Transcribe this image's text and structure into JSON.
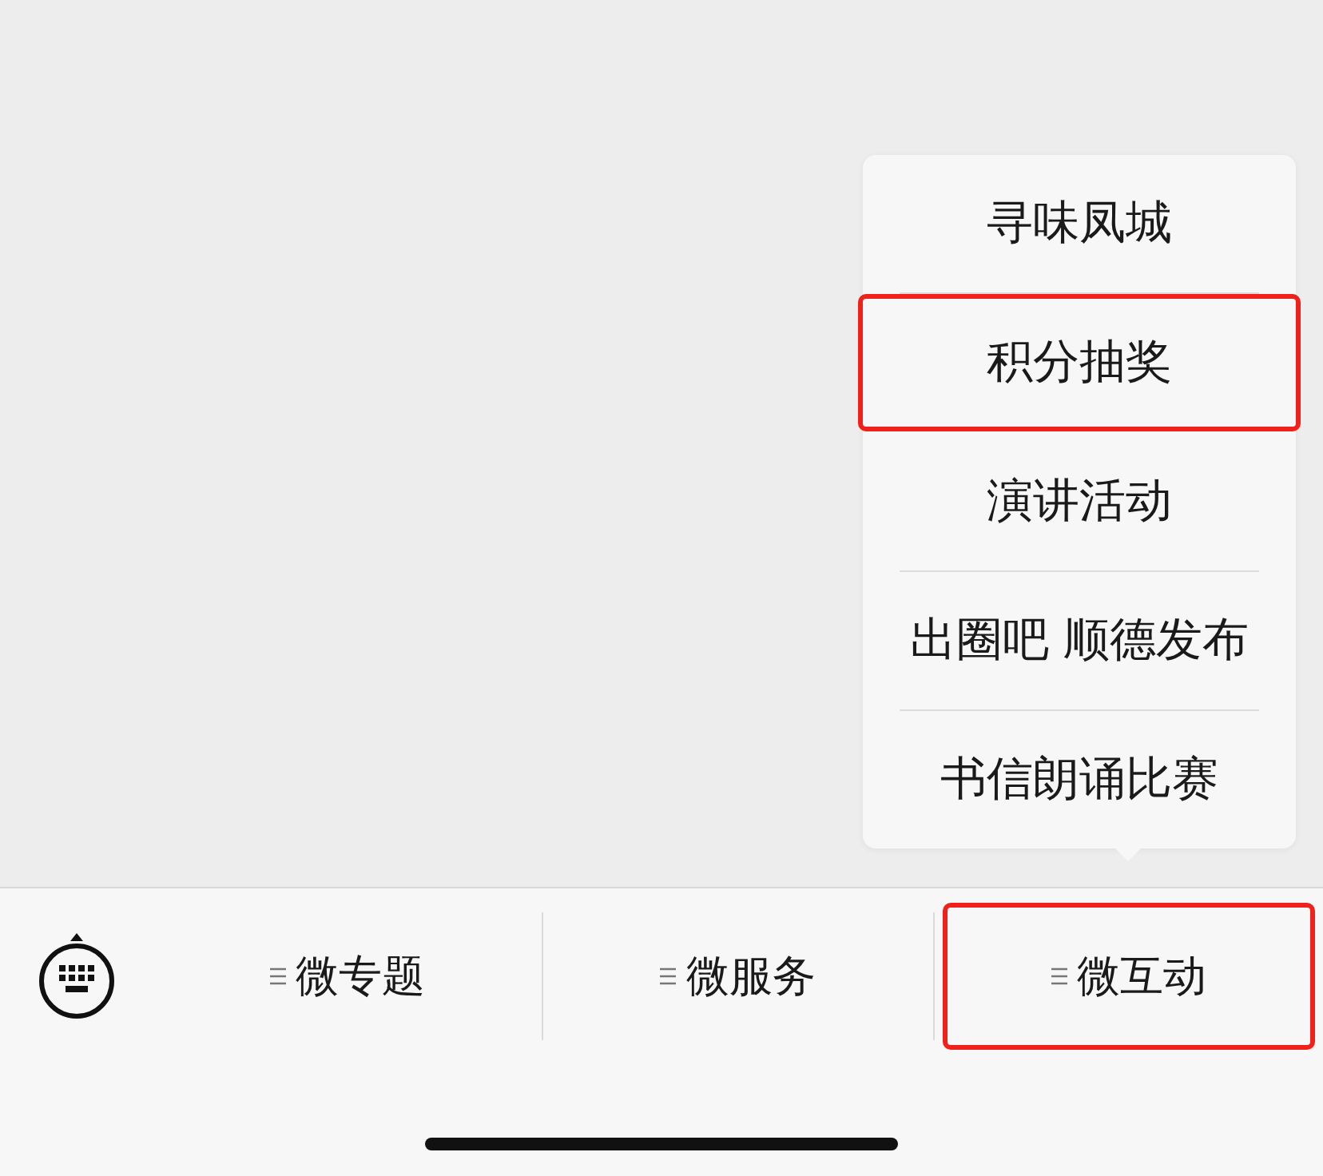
{
  "popup_menu": {
    "items": [
      {
        "label": "寻味凤城",
        "highlighted": false
      },
      {
        "label": "积分抽奖",
        "highlighted": true
      },
      {
        "label": "演讲活动",
        "highlighted": false
      },
      {
        "label": "出圈吧 顺德发布",
        "highlighted": false
      },
      {
        "label": "书信朗诵比赛",
        "highlighted": false
      }
    ]
  },
  "menu_bar": {
    "tabs": [
      {
        "label": "微专题",
        "highlighted": false
      },
      {
        "label": "微服务",
        "highlighted": false
      },
      {
        "label": "微互动",
        "highlighted": true
      }
    ]
  }
}
